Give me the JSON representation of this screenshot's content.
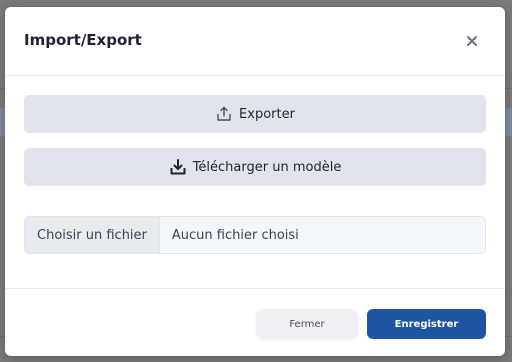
{
  "dialog": {
    "title": "Import/Export",
    "close_icon": "close-icon"
  },
  "actions": {
    "export": {
      "label": "Exporter",
      "icon": "upload-icon"
    },
    "download_template": {
      "label": "Télécharger un modèle",
      "icon": "download-icon"
    }
  },
  "file_input": {
    "button_label": "Choisir un fichier",
    "status": "Aucun fichier choisi"
  },
  "footer": {
    "close_label": "Fermer",
    "save_label": "Enregistrer"
  },
  "colors": {
    "primary": "#1f56a3",
    "action_bg": "#e1e4ec",
    "overlay": "#7a7a7a"
  }
}
